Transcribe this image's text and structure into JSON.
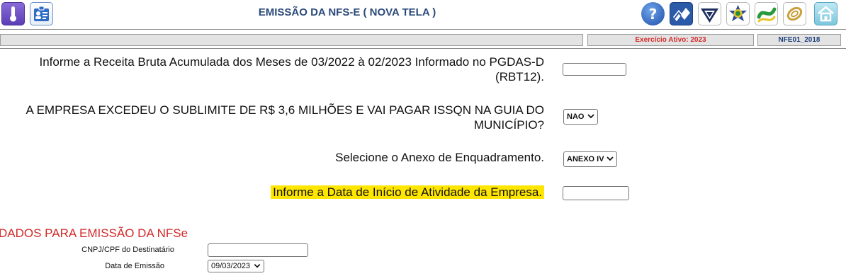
{
  "header": {
    "title": "EMISSÃO DA NFS-E ( NOVA TELA )"
  },
  "toolbar_left": [
    "thermometer-icon",
    "id-card-icon"
  ],
  "toolbar_right": [
    "help-icon",
    "municipality-logo-icon",
    "receita-federal-icon",
    "brasil-coat-of-arms-icon",
    "simples-nacional-icon",
    "infinity-logo-icon",
    "home-icon"
  ],
  "status": {
    "exercicio": "Exercício Ativo: 2023",
    "code": "NFE01_2018"
  },
  "form": {
    "q_rbt12": "Informe a Receita Bruta Acumulada dos Meses de 03/2022 à 02/2023 Informado no PGDAS-D (RBT12).",
    "q_sublimite": "A EMPRESA EXCEDEU O SUBLIMITE DE R$ 3,6 MILHÕES E VAI PAGAR ISSQN NA GUIA DO MUNICÍPIO?",
    "sublimite_value": "NAO",
    "q_anexo": "Selecione o Anexo de Enquadramento.",
    "anexo_value": "ANEXO IV",
    "q_data_inicio": "Informe a Data de Início de Atividade da Empresa."
  },
  "emissao": {
    "section_title": "DADOS PARA EMISSÃO DA NFSe",
    "cnpj_label": "CNPJ/CPF do Destinatário",
    "data_label": "Data de Emissão",
    "data_value": "09/03/2023"
  },
  "colors": {
    "title": "#2b4a7a",
    "section": "#d42a2a",
    "highlight": "#ffe600",
    "exercicio": "#d42a2a",
    "code": "#1f3f7a"
  }
}
